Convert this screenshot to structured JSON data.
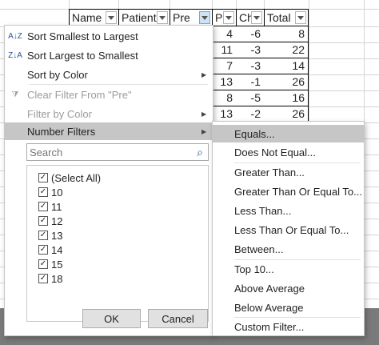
{
  "headers": [
    {
      "label": "Name",
      "active": false
    },
    {
      "label": "Patient",
      "active": false
    },
    {
      "label": "Pre",
      "active": true
    },
    {
      "label": "Po",
      "active": false
    },
    {
      "label": "Ch",
      "active": false
    },
    {
      "label": "Total",
      "active": false
    }
  ],
  "visible_rows": [
    [
      "4",
      "-6",
      "8"
    ],
    [
      "11",
      "-3",
      "22"
    ],
    [
      "7",
      "-3",
      "14"
    ],
    [
      "13",
      "-1",
      "26"
    ],
    [
      "8",
      "-5",
      "16"
    ],
    [
      "13",
      "-2",
      "26"
    ]
  ],
  "menu": {
    "sort_asc": "Sort Smallest to Largest",
    "sort_desc": "Sort Largest to Smallest",
    "sort_color": "Sort by Color",
    "clear_filter": "Clear Filter From \"Pre\"",
    "filter_color": "Filter by Color",
    "number_filters": "Number Filters",
    "search_placeholder": "Search",
    "select_all": "(Select All)",
    "values": [
      "10",
      "11",
      "12",
      "13",
      "14",
      "15",
      "18"
    ],
    "ok": "OK",
    "cancel": "Cancel"
  },
  "submenu": {
    "items": [
      "Equals...",
      "Does Not Equal...",
      "Greater Than...",
      "Greater Than Or Equal To...",
      "Less Than...",
      "Less Than Or Equal To...",
      "Between...",
      "Top 10...",
      "Above Average",
      "Below Average",
      "Custom Filter..."
    ]
  },
  "icons": {
    "sort_asc": "sort-ascending-icon",
    "sort_desc": "sort-descending-icon",
    "clear_filter": "clear-filter-icon",
    "search": "magnifier-icon",
    "submenu_arrow": "chevron-right-icon",
    "checkbox": "checkmark-icon"
  },
  "colors": {
    "highlight": "#c6c6c6",
    "accent": "#2b579a",
    "bottom_bar": "#7a7a7a"
  }
}
